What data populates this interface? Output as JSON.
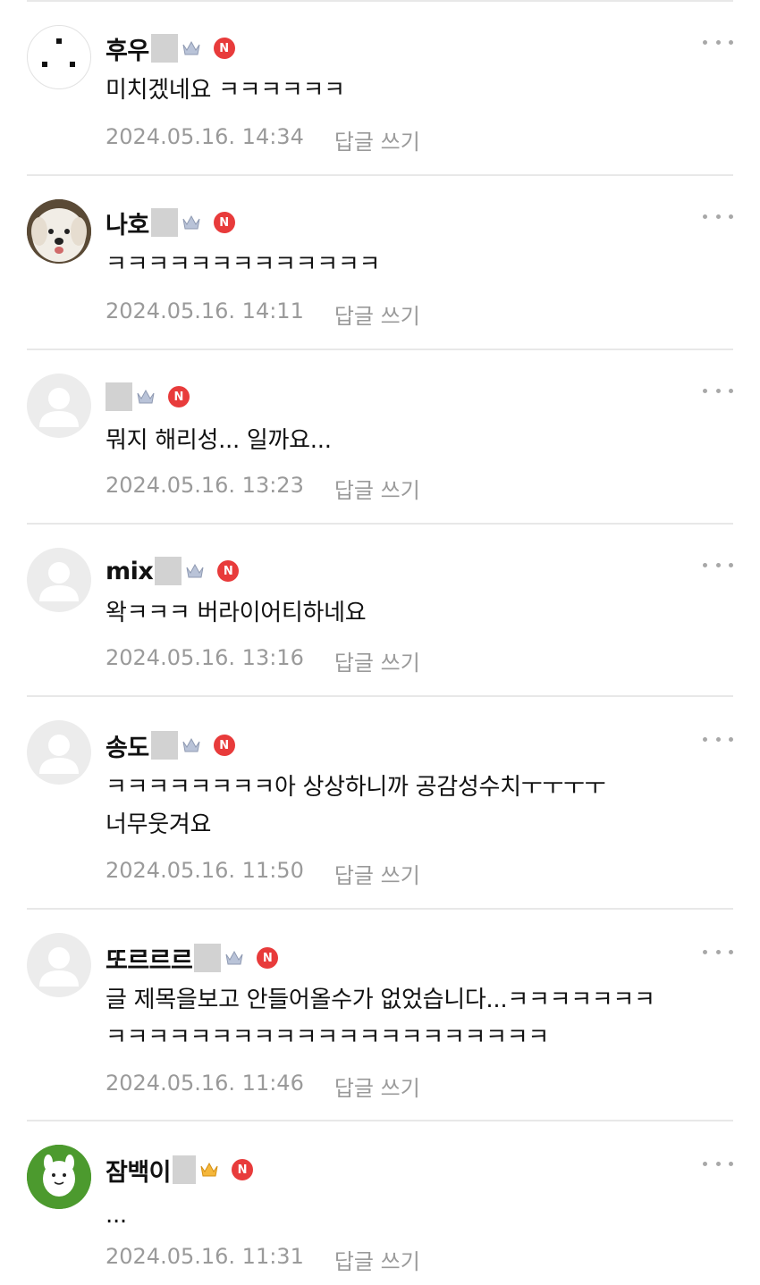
{
  "comments": [
    {
      "nickname": "후우",
      "blurred": true,
      "text": "미치겠네요 ㅋㅋㅋㅋㅋㅋ",
      "date": "2024.05.16. 14:34",
      "reply_label": "답글 쓰기",
      "avatar": "three-dots",
      "crown_color": "#b9c3d8"
    },
    {
      "nickname": "나호",
      "blurred": true,
      "text": "ㅋㅋㅋㅋㅋㅋㅋㅋㅋㅋㅋㅋㅋ",
      "date": "2024.05.16. 14:11",
      "reply_label": "답글 쓰기",
      "avatar": "dog",
      "crown_color": "#b9c3d8"
    },
    {
      "nickname": "",
      "blurred": true,
      "text": "뭐지 해리성... 일까요...",
      "date": "2024.05.16. 13:23",
      "reply_label": "답글 쓰기",
      "avatar": "default",
      "crown_color": "#b9c3d8"
    },
    {
      "nickname": "mix",
      "blurred": true,
      "text": "왁ㅋㅋㅋ 버라이어티하네요",
      "date": "2024.05.16. 13:16",
      "reply_label": "답글 쓰기",
      "avatar": "default",
      "crown_color": "#b9c3d8"
    },
    {
      "nickname": "송도",
      "blurred": true,
      "text": "ㅋㅋㅋㅋㅋㅋㅋㅋ아 상상하니까 공감성수치ㅜㅜㅜㅜ\n너무웃겨요",
      "date": "2024.05.16. 11:50",
      "reply_label": "답글 쓰기",
      "avatar": "default",
      "crown_color": "#b9c3d8"
    },
    {
      "nickname": "또르르르",
      "blurred": true,
      "text": "글 제목을보고 안들어올수가 없었습니다...ㅋㅋㅋㅋㅋㅋㅋ\nㅋㅋㅋㅋㅋㅋㅋㅋㅋㅋㅋㅋㅋㅋㅋㅋㅋㅋㅋㅋㅋ",
      "date": "2024.05.16. 11:46",
      "reply_label": "답글 쓰기",
      "avatar": "default",
      "crown_color": "#b9c3d8"
    },
    {
      "nickname": "잠백이",
      "blurred": true,
      "text": "...",
      "date": "2024.05.16. 11:31",
      "reply_label": "답글 쓰기",
      "avatar": "character",
      "crown_color": "#f5b73b"
    }
  ],
  "badge_letter": "N",
  "colors": {
    "new_badge": "#e83b3b",
    "meta_text": "#9a9a9a",
    "divider": "#e8e8e8"
  }
}
